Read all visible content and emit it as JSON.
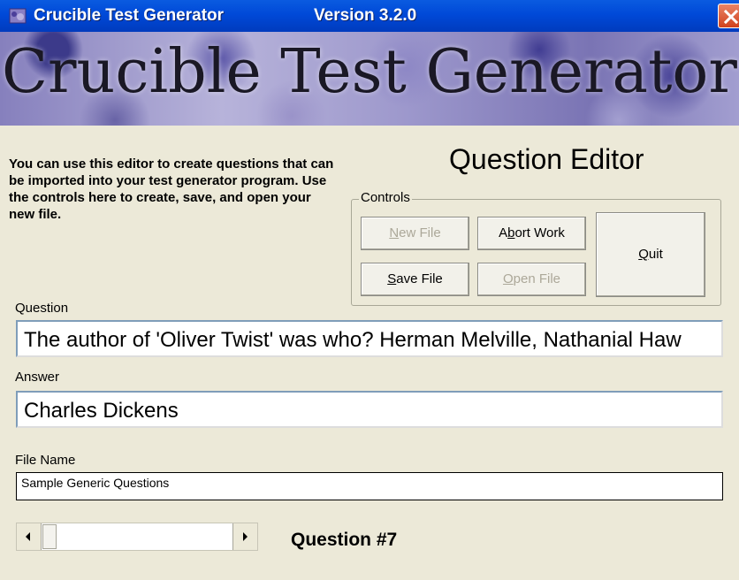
{
  "window": {
    "app_title": "Crucible Test Generator",
    "version": "Version 3.2.0"
  },
  "banner": {
    "text": "Crucible Test Generator"
  },
  "description": "You can use this editor to create questions that can be imported into your test generator program.  Use the controls here to create, save, and open your new file.",
  "heading": "Question Editor",
  "controls": {
    "group_label": "Controls",
    "new_file": "New File",
    "abort_work": "Abort Work",
    "quit": "Quit",
    "save_file": "Save File",
    "open_file": "Open File"
  },
  "question": {
    "label": "Question",
    "value": "The author of 'Oliver Twist' was who? Herman Melville, Nathanial Haw"
  },
  "answer": {
    "label": "Answer",
    "value": "Charles Dickens"
  },
  "file_name": {
    "label": "File Name",
    "value": "Sample Generic Questions"
  },
  "navigation": {
    "question_number": "Question #7"
  }
}
